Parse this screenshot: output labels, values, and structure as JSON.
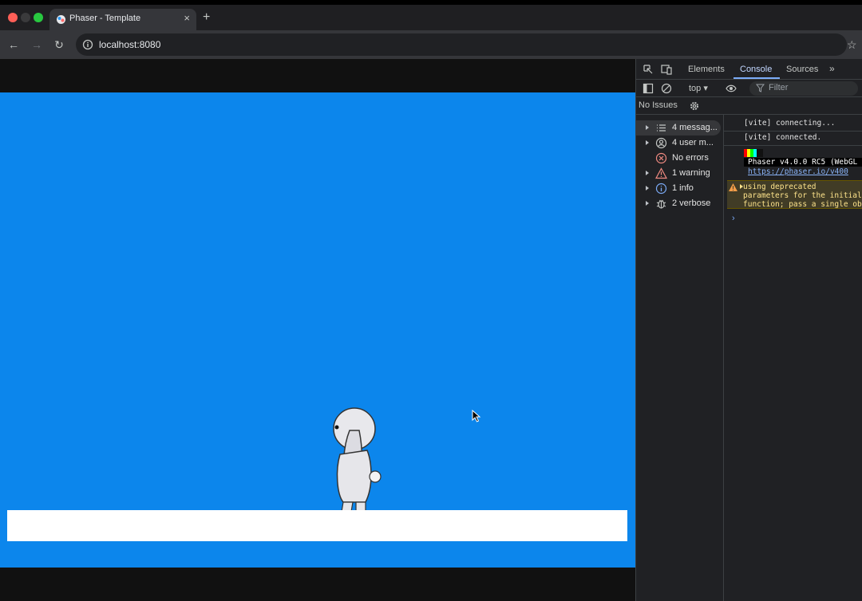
{
  "browser": {
    "tab_title": "Phaser - Template",
    "tab_close": "×",
    "new_tab": "+",
    "url": "localhost:8080"
  },
  "devtools": {
    "tabs": [
      "Elements",
      "Console",
      "Sources"
    ],
    "more": "»",
    "context": "top ▾",
    "filter_placeholder": "Filter",
    "issues": "No Issues",
    "sidebar": [
      {
        "label": "4 messag...",
        "icon": "list-icon",
        "expandable": true,
        "selected": true
      },
      {
        "label": "4 user m...",
        "icon": "user-icon",
        "expandable": true,
        "selected": false
      },
      {
        "label": "No errors",
        "icon": "error-icon",
        "expandable": false,
        "selected": false
      },
      {
        "label": "1 warning",
        "icon": "warning-icon",
        "expandable": true,
        "selected": false
      },
      {
        "label": "1 info",
        "icon": "info-icon",
        "expandable": true,
        "selected": false
      },
      {
        "label": "2 verbose",
        "icon": "bug-icon",
        "expandable": true,
        "selected": false
      }
    ],
    "console": {
      "lines": [
        "[vite] connecting...",
        "[vite] connected."
      ],
      "phaser_banner": "Phaser v4.0.0 RC5 (WebGL",
      "phaser_link": "https://phaser.io/v400",
      "warning": "using deprecated\nparameters for the initial\nfunction; pass a single ob",
      "prompt": "›"
    }
  },
  "colors": {
    "game_bg": "#0c86ec",
    "ground": "#ffffff",
    "accent": "#7cacf8"
  }
}
